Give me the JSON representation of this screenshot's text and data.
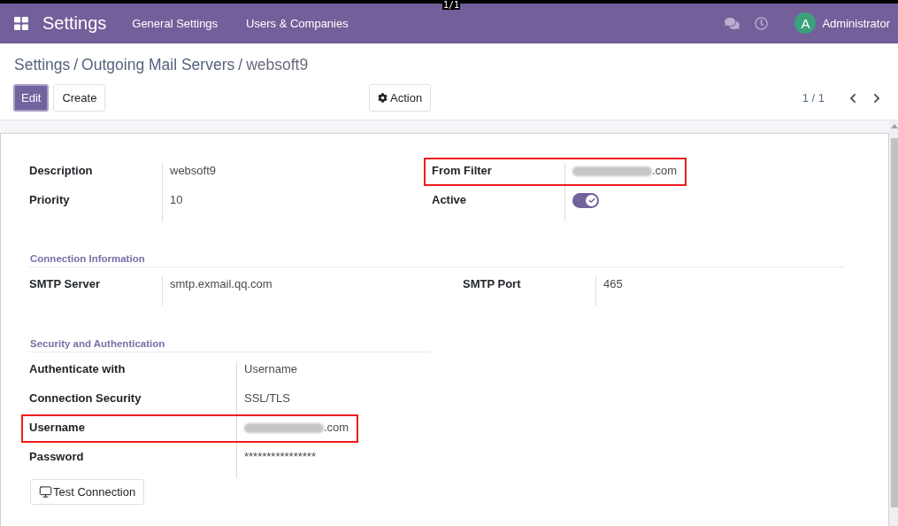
{
  "top_strip": {
    "page_counter": "1/1"
  },
  "navbar": {
    "app_name": "Settings",
    "menu": [
      {
        "label": "General Settings"
      },
      {
        "label": "Users & Companies"
      }
    ],
    "user": {
      "initial": "A",
      "name": "Administrator"
    }
  },
  "breadcrumb": {
    "separator": "/",
    "items": [
      {
        "label": "Settings"
      },
      {
        "label": "Outgoing Mail Servers"
      },
      {
        "label": "websoft9"
      }
    ]
  },
  "buttons": [
    {
      "label": "Edit",
      "kind": "primary"
    },
    {
      "label": "Create",
      "kind": "secondary"
    }
  ],
  "action_menu": {
    "label": "Action"
  },
  "pager": {
    "value": "1 / 1"
  },
  "form": {
    "main_group": {
      "columns": [
        [
          {
            "kind": "text",
            "label": "Description",
            "value": "websoft9",
            "redacted": false,
            "highlighted": false
          },
          {
            "kind": "text",
            "label": "Priority",
            "value": "10",
            "redacted": false,
            "highlighted": false
          }
        ],
        [
          {
            "kind": "text",
            "label": "From Filter",
            "value": ".com",
            "redacted": true,
            "highlighted": true
          },
          {
            "kind": "toggle",
            "label": "Active",
            "on": true,
            "highlighted": false
          }
        ]
      ]
    },
    "sections": [
      {
        "title": "Connection Information",
        "columns": [
          [
            {
              "kind": "text",
              "label": "SMTP Server",
              "value": "smtp.exmail.qq.com",
              "redacted": false,
              "highlighted": false
            }
          ],
          [
            {
              "kind": "text",
              "label": "SMTP Port",
              "value": "465",
              "redacted": false,
              "highlighted": false
            }
          ]
        ]
      },
      {
        "title": "Security and Authentication",
        "columns": [
          [
            {
              "kind": "text",
              "label": "Authenticate with",
              "value": "Username",
              "redacted": false,
              "highlighted": false
            },
            {
              "kind": "text",
              "label": "Connection Security",
              "value": "SSL/TLS",
              "redacted": false,
              "highlighted": false
            },
            {
              "kind": "text",
              "label": "Username",
              "value": ".com",
              "redacted": true,
              "highlighted": true
            },
            {
              "kind": "text",
              "label": "Password",
              "value": "****************",
              "redacted": false,
              "highlighted": false
            }
          ]
        ]
      }
    ],
    "test_button": {
      "label": "Test Connection"
    }
  }
}
